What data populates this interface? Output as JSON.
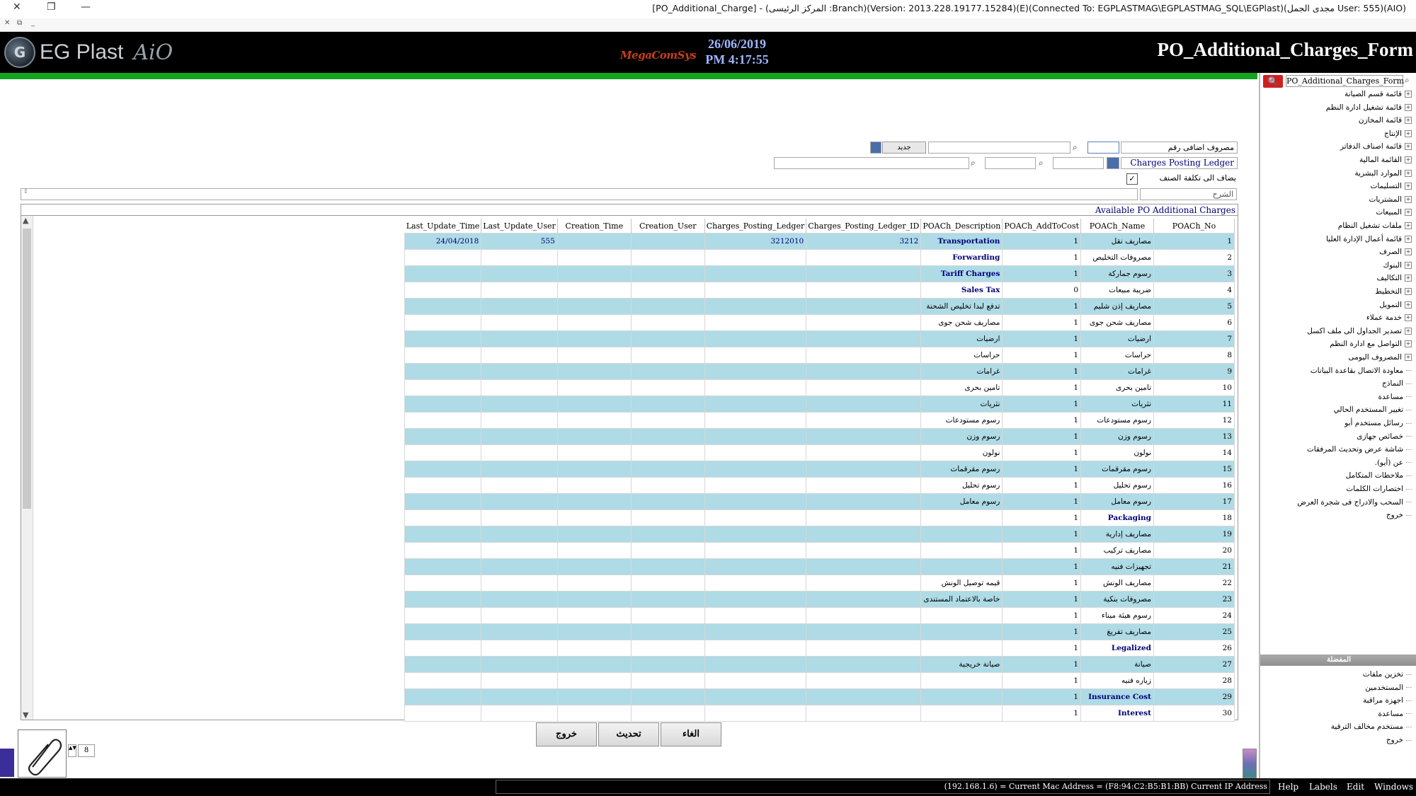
{
  "window": {
    "title": "[PO_Additional_Charge] - (المركز الرئيسى :Branch)(Version: 2013.228.19177.15284)(E)(Connected To: EGPLASTMAG\\EGPLASTMAG_SQL\\EGPlast)(مجدى الجمل User: 555)(AIO)"
  },
  "header": {
    "logo_text": "EG Plast",
    "logo_suffix": "AiO",
    "brand2": "MegaComSys",
    "date": "26/06/2019",
    "time": "PM 4:17:55",
    "form_title": "PO_Additional_Charges_Form"
  },
  "sidebar": {
    "search_value": "PO_Additional_Charges_Form",
    "tree": [
      {
        "label": "قائمة قسم الصيانة",
        "expandable": true
      },
      {
        "label": "قائمة تشغيل ادارة النظم",
        "expandable": true
      },
      {
        "label": "قائمة المخازن",
        "expandable": true
      },
      {
        "label": "الإنتاج",
        "expandable": true
      },
      {
        "label": "قائمة اصناف الدفاتر",
        "expandable": true
      },
      {
        "label": "القائمة المالية",
        "expandable": true
      },
      {
        "label": "الموارد البشرية",
        "expandable": true
      },
      {
        "label": "التسليمات",
        "expandable": true
      },
      {
        "label": "المشتريات",
        "expandable": true
      },
      {
        "label": "المبيعات",
        "expandable": true
      },
      {
        "label": "ملفات تشغيل النظام",
        "expandable": true
      },
      {
        "label": "قائمة أعمال الإدارة العليا",
        "expandable": true
      },
      {
        "label": "الصرف",
        "expandable": true
      },
      {
        "label": "البنوك",
        "expandable": true
      },
      {
        "label": "التكاليف",
        "expandable": true
      },
      {
        "label": "التخطيط",
        "expandable": true
      },
      {
        "label": "التمويل",
        "expandable": true
      },
      {
        "label": "خدمة عملاء",
        "expandable": true
      },
      {
        "label": "تصدير الجداول الى ملف اكسل",
        "expandable": true
      },
      {
        "label": "التواصل مع ادارة النظم",
        "expandable": true
      },
      {
        "label": "المصروف اليومى",
        "expandable": true
      },
      {
        "label": "معاودة الاتصال بقاعدة البيانات",
        "expandable": false
      },
      {
        "label": "النماذج",
        "expandable": false
      },
      {
        "label": "مساعدة",
        "expandable": false
      },
      {
        "label": "تغيير المستخدم الحالي",
        "expandable": false
      },
      {
        "label": "رسائل مستخدم أبو",
        "expandable": false
      },
      {
        "label": "خصائص جهازى",
        "expandable": false
      },
      {
        "label": "شاشة عرض وتحديث المرفقات",
        "expandable": false
      },
      {
        "label": "عن (أيو).",
        "expandable": false
      },
      {
        "label": "ملاحظات المتكامل",
        "expandable": false
      },
      {
        "label": "اختصارات الكلمات",
        "expandable": false
      },
      {
        "label": "السحب والادراج فى شجرة العرض",
        "expandable": false
      },
      {
        "label": "خروج",
        "expandable": false
      }
    ],
    "favorites_header": "المفضلة",
    "favorites": [
      {
        "label": "تخزين ملفات"
      },
      {
        "label": "المستخدمين"
      },
      {
        "label": "اجهزة مراقبة"
      },
      {
        "label": "مساعدة"
      },
      {
        "label": "مستخدم مخالف الترقية"
      },
      {
        "label": "خروج"
      }
    ]
  },
  "form": {
    "charge_no_label": "مصروف اضافى رقم",
    "charge_no_value": "",
    "new_button": "جديد",
    "posting_ledger_label": "Charges Posting Ledger",
    "add_to_cost_label": "يضاف الى تكلفة الصنف",
    "add_to_cost_checked": true,
    "description_label": "الشرح",
    "description_value": ""
  },
  "grid": {
    "caption": "Available PO Additional Charges",
    "columns": [
      "Last_Update_Time",
      "Last_Update_User",
      "Creation_Time",
      "Creation_User",
      "Charges_Posting_Ledger",
      "Charges_Posting_Ledger_ID",
      "POACh_Description",
      "POACh_AddToCost",
      "POACh_Name",
      "POACh_No"
    ],
    "rows": [
      {
        "no": "1",
        "name": "مصاريف نقل",
        "add": "1",
        "desc": "Transportation",
        "ledger_id": "3212",
        "ledger": "3212010",
        "cuser": "",
        "ctime": "",
        "luser": "555",
        "ltime": "24/04/2018"
      },
      {
        "no": "2",
        "name": "مصروفات التخليص",
        "add": "1",
        "desc": "Forwarding",
        "ledger_id": "",
        "ledger": "",
        "cuser": "",
        "ctime": "",
        "luser": "",
        "ltime": ""
      },
      {
        "no": "3",
        "name": "رسوم جماركة",
        "add": "1",
        "desc": "Tariff Charges",
        "ledger_id": "",
        "ledger": "",
        "cuser": "",
        "ctime": "",
        "luser": "",
        "ltime": ""
      },
      {
        "no": "4",
        "name": "ضريبة مبيعات",
        "add": "0",
        "desc": "Sales Tax",
        "ledger_id": "",
        "ledger": "",
        "cuser": "",
        "ctime": "",
        "luser": "",
        "ltime": ""
      },
      {
        "no": "5",
        "name": "مصاريف إذن شليم",
        "add": "1",
        "desc": "تدفع لبدا تخليص الشحنة",
        "ledger_id": "",
        "ledger": "",
        "cuser": "",
        "ctime": "",
        "luser": "",
        "ltime": ""
      },
      {
        "no": "6",
        "name": "مصاريف شحن جوى",
        "add": "1",
        "desc": "مصاريف شحن جوى",
        "ledger_id": "",
        "ledger": "",
        "cuser": "",
        "ctime": "",
        "luser": "",
        "ltime": ""
      },
      {
        "no": "7",
        "name": "ارضيات",
        "add": "1",
        "desc": "ارضيات",
        "ledger_id": "",
        "ledger": "",
        "cuser": "",
        "ctime": "",
        "luser": "",
        "ltime": ""
      },
      {
        "no": "8",
        "name": "حراسات",
        "add": "1",
        "desc": "حراسات",
        "ledger_id": "",
        "ledger": "",
        "cuser": "",
        "ctime": "",
        "luser": "",
        "ltime": ""
      },
      {
        "no": "9",
        "name": "غرامات",
        "add": "1",
        "desc": "غرامات",
        "ledger_id": "",
        "ledger": "",
        "cuser": "",
        "ctime": "",
        "luser": "",
        "ltime": ""
      },
      {
        "no": "10",
        "name": "تامين بحرى",
        "add": "1",
        "desc": "تامين بحرى",
        "ledger_id": "",
        "ledger": "",
        "cuser": "",
        "ctime": "",
        "luser": "",
        "ltime": ""
      },
      {
        "no": "11",
        "name": "نثريات",
        "add": "1",
        "desc": "نثريات",
        "ledger_id": "",
        "ledger": "",
        "cuser": "",
        "ctime": "",
        "luser": "",
        "ltime": ""
      },
      {
        "no": "12",
        "name": "رسوم مستودعات",
        "add": "1",
        "desc": "رسوم مستودعات",
        "ledger_id": "",
        "ledger": "",
        "cuser": "",
        "ctime": "",
        "luser": "",
        "ltime": ""
      },
      {
        "no": "13",
        "name": "رسوم وزن",
        "add": "1",
        "desc": "رسوم وزن",
        "ledger_id": "",
        "ledger": "",
        "cuser": "",
        "ctime": "",
        "luser": "",
        "ltime": ""
      },
      {
        "no": "14",
        "name": "نولون",
        "add": "1",
        "desc": "نولون",
        "ledger_id": "",
        "ledger": "",
        "cuser": "",
        "ctime": "",
        "luser": "",
        "ltime": ""
      },
      {
        "no": "15",
        "name": "رسوم مقرقمات",
        "add": "1",
        "desc": "رسوم مقرقمات",
        "ledger_id": "",
        "ledger": "",
        "cuser": "",
        "ctime": "",
        "luser": "",
        "ltime": ""
      },
      {
        "no": "16",
        "name": "رسوم تحليل",
        "add": "1",
        "desc": "رسوم تحليل",
        "ledger_id": "",
        "ledger": "",
        "cuser": "",
        "ctime": "",
        "luser": "",
        "ltime": ""
      },
      {
        "no": "17",
        "name": "رسوم معامل",
        "add": "1",
        "desc": "رسوم معامل",
        "ledger_id": "",
        "ledger": "",
        "cuser": "",
        "ctime": "",
        "luser": "",
        "ltime": ""
      },
      {
        "no": "18",
        "name": "Packaging",
        "add": "1",
        "desc": "",
        "ledger_id": "",
        "ledger": "",
        "cuser": "",
        "ctime": "",
        "luser": "",
        "ltime": ""
      },
      {
        "no": "19",
        "name": "مصاريف إدارية",
        "add": "1",
        "desc": "",
        "ledger_id": "",
        "ledger": "",
        "cuser": "",
        "ctime": "",
        "luser": "",
        "ltime": ""
      },
      {
        "no": "20",
        "name": "مصاريف تركيب",
        "add": "1",
        "desc": "",
        "ledger_id": "",
        "ledger": "",
        "cuser": "",
        "ctime": "",
        "luser": "",
        "ltime": ""
      },
      {
        "no": "21",
        "name": "تجهيزات فنيه",
        "add": "1",
        "desc": "",
        "ledger_id": "",
        "ledger": "",
        "cuser": "",
        "ctime": "",
        "luser": "",
        "ltime": ""
      },
      {
        "no": "22",
        "name": "مصاريف الونش",
        "add": "1",
        "desc": "قيمه توصيل الونش",
        "ledger_id": "",
        "ledger": "",
        "cuser": "",
        "ctime": "",
        "luser": "",
        "ltime": ""
      },
      {
        "no": "23",
        "name": "مصروفات بنكية",
        "add": "1",
        "desc": "خاصة بالاعتماد المستندى",
        "ledger_id": "",
        "ledger": "",
        "cuser": "",
        "ctime": "",
        "luser": "",
        "ltime": ""
      },
      {
        "no": "24",
        "name": "رسوم هيئة ميناء",
        "add": "1",
        "desc": "",
        "ledger_id": "",
        "ledger": "",
        "cuser": "",
        "ctime": "",
        "luser": "",
        "ltime": ""
      },
      {
        "no": "25",
        "name": "مصاريف تفريغ",
        "add": "1",
        "desc": "",
        "ledger_id": "",
        "ledger": "",
        "cuser": "",
        "ctime": "",
        "luser": "",
        "ltime": ""
      },
      {
        "no": "26",
        "name": "Legalized",
        "add": "1",
        "desc": "",
        "ledger_id": "",
        "ledger": "",
        "cuser": "",
        "ctime": "",
        "luser": "",
        "ltime": ""
      },
      {
        "no": "27",
        "name": "صيانة",
        "add": "1",
        "desc": "صيانة خريجية",
        "ledger_id": "",
        "ledger": "",
        "cuser": "",
        "ctime": "",
        "luser": "",
        "ltime": ""
      },
      {
        "no": "28",
        "name": "زياره فنيه",
        "add": "1",
        "desc": "",
        "ledger_id": "",
        "ledger": "",
        "cuser": "",
        "ctime": "",
        "luser": "",
        "ltime": ""
      },
      {
        "no": "29",
        "name": "Insurance Cost",
        "add": "1",
        "desc": "",
        "ledger_id": "",
        "ledger": "",
        "cuser": "",
        "ctime": "",
        "luser": "",
        "ltime": ""
      },
      {
        "no": "30",
        "name": "Interest",
        "add": "1",
        "desc": "",
        "ledger_id": "",
        "ledger": "",
        "cuser": "",
        "ctime": "",
        "luser": "",
        "ltime": ""
      }
    ]
  },
  "buttons": {
    "cancel": "الغاء",
    "refresh": "تحديث",
    "exit": "خروج"
  },
  "attachments": {
    "count": "8"
  },
  "statusbar": {
    "ip_text": "(192.168.1.6) = Current Mac Address = (F8:94:C2:B5:B1:BB) Current IP Address",
    "menu": [
      "Help",
      "Labels",
      "Edit",
      "Windows"
    ]
  },
  "colors": {
    "banner_bg": "#000000",
    "progress_green": "#13a51f",
    "grid_alt_row": "#aedbe6",
    "blue_text": "#00007a"
  }
}
